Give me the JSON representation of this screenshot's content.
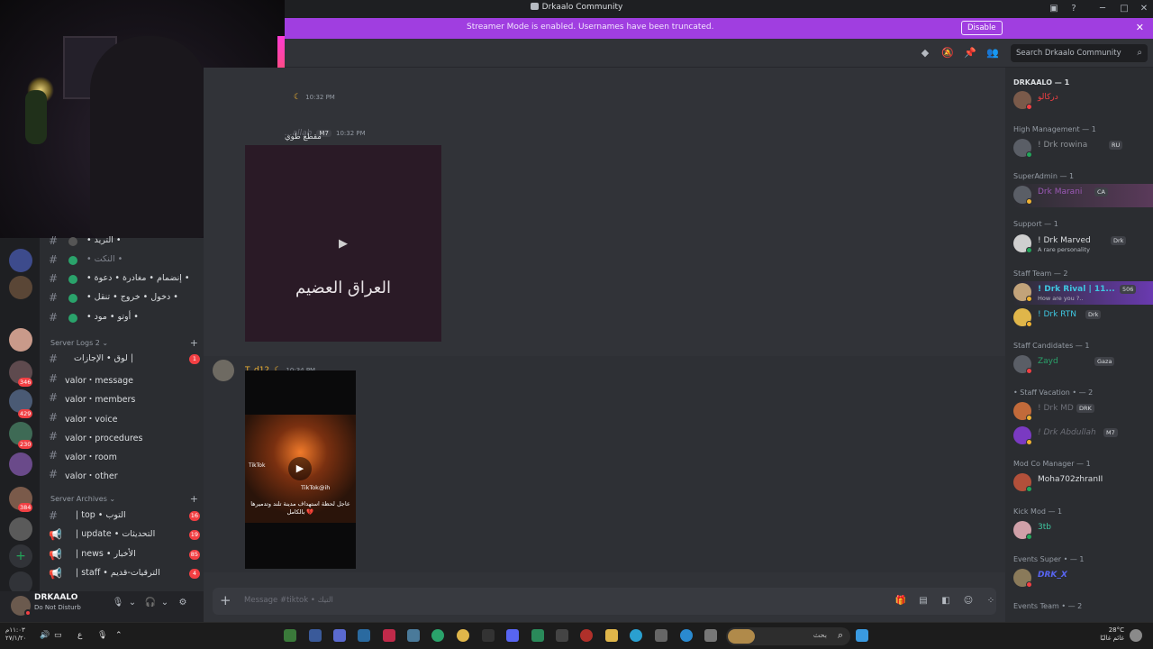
{
  "window": {
    "title": "Drkaalo Community"
  },
  "banner": {
    "message": "Streamer Mode is enabled. Usernames have been truncated.",
    "disable_label": "Disable"
  },
  "header": {
    "search_placeholder": "Search Drkaalo Community"
  },
  "guild_badges": [
    "346",
    "429",
    "230",
    "384"
  ],
  "channels": {
    "rows": [
      {
        "label": "• التريد •"
      },
      {
        "label": "• النكت •"
      },
      {
        "label": "• إنضمام • مغادرة • دعوة •"
      },
      {
        "label": "• دخول • خروج • تنقل •"
      },
      {
        "label": "• أوتو • مود •"
      }
    ],
    "server_logs": {
      "label": "Server Logs 2"
    },
    "log_rows": [
      {
        "label": "لوق • الإجازات |",
        "count": "1"
      },
      {
        "label": "valor・message"
      },
      {
        "label": "valor・members"
      },
      {
        "label": "valor・voice"
      },
      {
        "label": "valor・procedures"
      },
      {
        "label": "valor・room"
      },
      {
        "label": "valor・other"
      }
    ],
    "server_archives": {
      "label": "Server Archives"
    },
    "archive_rows": [
      {
        "label": "| top • التوب",
        "count": "16"
      },
      {
        "label": "| update • التحديثات",
        "count": "19"
      },
      {
        "label": "| news • الأخبار",
        "count": "85"
      },
      {
        "label": "| staff • الترقيات-قديم",
        "count": "4"
      }
    ]
  },
  "user": {
    "name": "DRKAALO",
    "status": "Do Not Disturb"
  },
  "chat": {
    "msg1": {
      "time": "10:32 PM"
    },
    "msg2": {
      "author": "...allah",
      "badge": "M7",
      "time": "10:32 PM",
      "text": "مقطع طوي"
    },
    "video1": {
      "caption": "العراق العضيم"
    },
    "msg3": {
      "author": "T_d12",
      "time": "10:34 PM"
    },
    "video2": {
      "tag": "TikTok@ih",
      "caption": "عاجل لحظة استهداف مدينة تلند وتدميرها بالكامل 💔",
      "tiktok": "TikTok"
    },
    "composer_placeholder": "Message #tiktok • التيك"
  },
  "members": {
    "groups": [
      {
        "label": "DRKAALO — 1"
      },
      {
        "label": "High Management — 1"
      },
      {
        "label": "SuperAdmin — 1"
      },
      {
        "label": "Support — 1"
      },
      {
        "label": "Staff Team — 2"
      },
      {
        "label": "Staff Candidates — 1"
      },
      {
        "label": "• Staff Vacation • — 2"
      },
      {
        "label": "Mod Co Manager — 1"
      },
      {
        "label": "Kick Mod — 1"
      },
      {
        "label": "Events Super • — 1"
      },
      {
        "label": "Events Team • — 2"
      }
    ],
    "list": [
      {
        "name": "دركالو",
        "color": "#f23f43"
      },
      {
        "name": "! Drk rowina",
        "tag": "RU",
        "color": "#8e9297"
      },
      {
        "name": "Drk Marani",
        "tag": "CA",
        "color": "#9b59b6"
      },
      {
        "name": "! Drk Marved",
        "tag": "Drk",
        "sub": "A rare personality",
        "color": "#dbdee1"
      },
      {
        "name": "! Drk Rival | 11...",
        "tag": "506",
        "sub": "How are you ?..",
        "color": "#3ec6e0"
      },
      {
        "name": "! Drk RTN",
        "tag": "Drk",
        "color": "#3ec6e0"
      },
      {
        "name": "Zayd",
        "tag": "Gaza",
        "color": "#2aa36b"
      },
      {
        "name": "! Drk MD",
        "tag": "DRK",
        "color": "#6d6f78"
      },
      {
        "name": "! Drk Abdullah",
        "tag": "M7",
        "color": "#6d6f78"
      },
      {
        "name": "Moha702zhranII",
        "color": "#dbdee1"
      },
      {
        "name": "3tb",
        "color": "#3ec6a0"
      },
      {
        "name": "DRK_X",
        "color": "#5865f2"
      }
    ]
  },
  "taskbar": {
    "clock": "١١:٠٣م",
    "date": "٢٧/١/٢٠",
    "weather_temp": "28°C",
    "weather_desc": "غائم غالبًا",
    "search_text": "بحث"
  },
  "colors": {
    "banner": "#a03ee0",
    "accent": "#5865f2",
    "online": "#23a55a",
    "dnd": "#f23f43"
  }
}
